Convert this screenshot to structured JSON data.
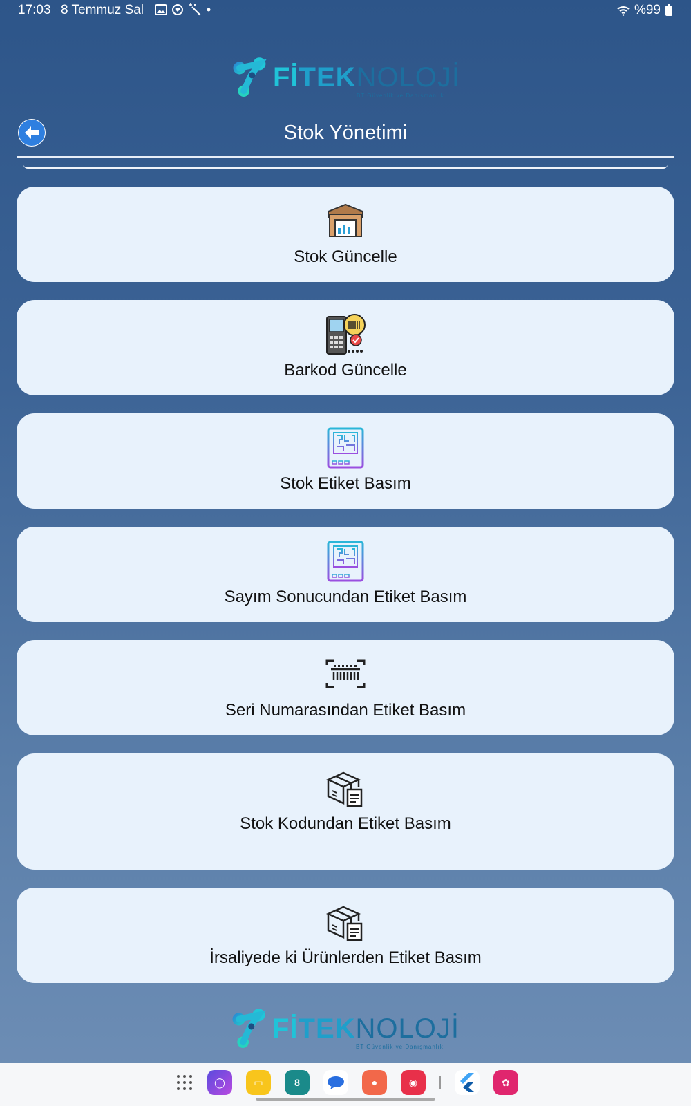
{
  "status_bar": {
    "time": "17:03",
    "date": "8 Temmuz Sal",
    "battery": "%99"
  },
  "logo": {
    "part1": "Fİ",
    "part2": "TEK",
    "part3": "NOLOJİ",
    "subtitle": "BT Güvenlik ve Danışmanlık"
  },
  "header": {
    "title": "Stok Yönetimi"
  },
  "menu": {
    "items": [
      {
        "label": "Stok Güncelle",
        "icon": "box-chart-icon"
      },
      {
        "label": "Barkod Güncelle",
        "icon": "barcode-scanner-icon"
      },
      {
        "label": "Stok Etiket Basım",
        "icon": "qr-label-icon"
      },
      {
        "label": "Sayım Sonucundan Etiket Basım",
        "icon": "qr-label-icon"
      },
      {
        "label": "Seri Numarasından Etiket Basım",
        "icon": "barcode-frame-icon"
      },
      {
        "label": "Stok Kodundan Etiket Basım",
        "icon": "boxes-doc-icon"
      },
      {
        "label": "İrsaliyede ki Ürünlerden Etiket Basım",
        "icon": "boxes-doc-icon"
      }
    ]
  },
  "colors": {
    "card_bg": "#e8f2fc",
    "accent": "#1f9fca",
    "bg_top": "#2d5589"
  }
}
